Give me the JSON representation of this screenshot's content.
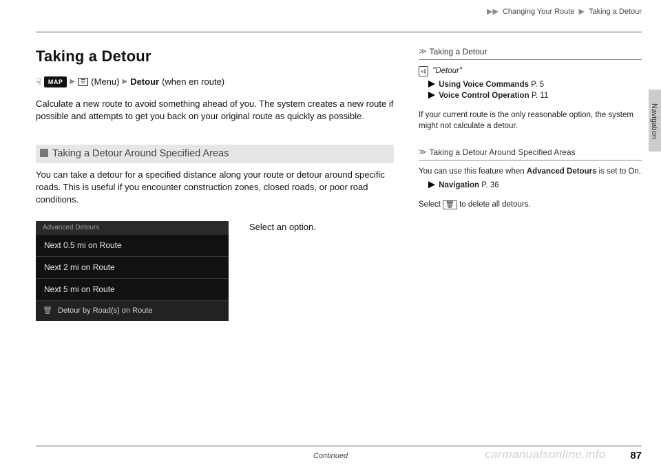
{
  "breadcrumb": {
    "sep": "▶▶",
    "a": "Changing Your Route",
    "b": "Taking a Detour"
  },
  "title": "Taking a Detour",
  "path": {
    "map": "MAP",
    "menu_label": "(Menu)",
    "menu_glyph": "☰",
    "action": "Detour",
    "suffix": "(when en route)"
  },
  "intro": "Calculate a new route to avoid something ahead of you. The system creates a new route if possible and attempts to get you back on your original route as quickly as possible.",
  "section2_title": "Taking a Detour Around Specified Areas",
  "section2_body": "You can take a detour for a specified distance along your route or detour around specific roads. This is useful if you encounter construction zones, closed roads, or poor road conditions.",
  "screen": {
    "title": "Advanced Detours",
    "items": [
      "Next 0.5 mi on Route",
      "Next 2 mi on Route",
      "Next 5 mi on Route"
    ],
    "last": "Detour by Road(s) on Route"
  },
  "instr": "Select an option.",
  "help1": {
    "heading": "Taking a Detour",
    "voice": "\"Detour\"",
    "link1_label": "Using Voice Commands",
    "link1_page": "P. 5",
    "link2_label": "Voice Control Operation",
    "link2_page": "P. 11",
    "note": "If your current route is the only reasonable option, the system might not calculate a detour."
  },
  "help2": {
    "heading": "Taking a Detour Around Specified Areas",
    "line1a": "You can use this feature when ",
    "line1b": "Advanced Detours",
    "line1c": " is set to On.",
    "link_label": "Navigation",
    "link_page": "P. 36",
    "line2a": "Select ",
    "trash_glyph": "🗑",
    "line2b": " to delete all detours."
  },
  "side_label": "Navigation",
  "continued": "Continued",
  "pagenum": "87",
  "watermark": "carmanualsonline.info"
}
